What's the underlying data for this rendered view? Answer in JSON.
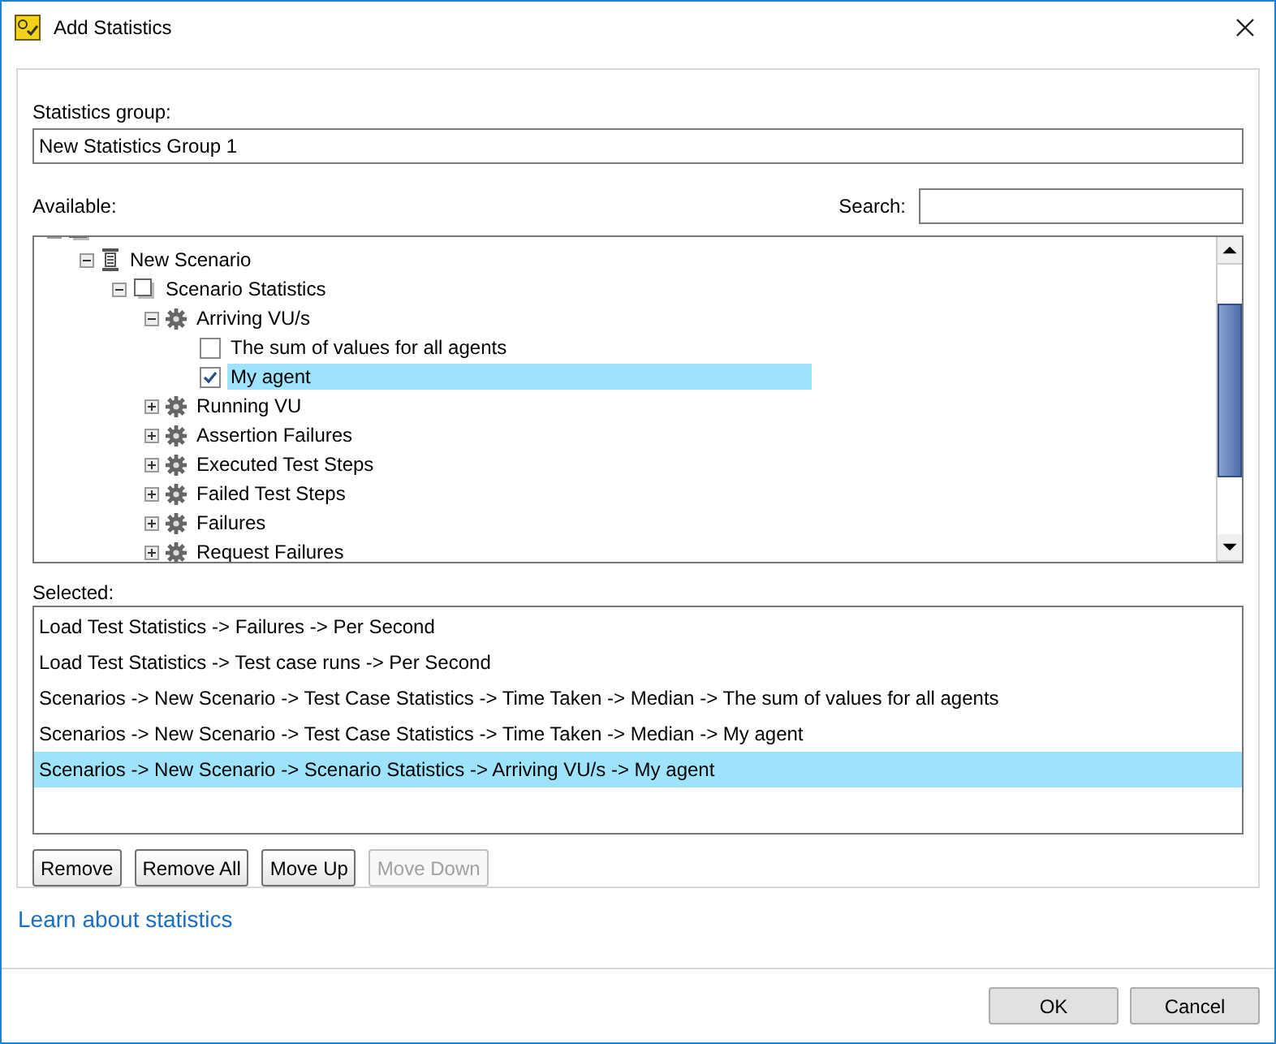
{
  "window": {
    "title": "Add Statistics"
  },
  "group_label": "Statistics group:",
  "group_name": "New Statistics Group 1",
  "available_label": "Available:",
  "search": {
    "label": "Search:"
  },
  "tree": [
    {
      "kind": "folder",
      "children": [
        {
          "label": "New Scenario",
          "kind": "scenario",
          "expanded": true,
          "children": [
            {
              "label": "Scenario Statistics",
              "kind": "folder",
              "expanded": true,
              "children": [
                {
                  "label": "Arriving VU/s",
                  "kind": "statistic",
                  "expanded": true,
                  "children": [
                    {
                      "label": "The sum of values for all agents",
                      "kind": "check",
                      "checked": false,
                      "selected": false
                    },
                    {
                      "label": "My agent",
                      "kind": "check",
                      "checked": true,
                      "selected": true
                    }
                  ]
                },
                {
                  "label": "Running VU",
                  "kind": "statistic",
                  "expanded": false
                },
                {
                  "label": "Assertion Failures",
                  "kind": "statistic",
                  "expanded": false
                },
                {
                  "label": "Executed Test Steps",
                  "kind": "statistic",
                  "expanded": false
                },
                {
                  "label": "Failed Test Steps",
                  "kind": "statistic",
                  "expanded": false
                },
                {
                  "label": "Failures",
                  "kind": "statistic",
                  "expanded": false
                },
                {
                  "label": "Request Failures",
                  "kind": "statistic",
                  "expanded": false
                }
              ]
            }
          ]
        }
      ]
    }
  ],
  "selected_label": "Selected:",
  "selected_items": [
    {
      "text": "Load Test Statistics -> Failures -> Per Second",
      "selected": false
    },
    {
      "text": "Load Test Statistics -> Test case runs -> Per Second",
      "selected": false
    },
    {
      "text": "Scenarios -> New Scenario -> Test Case Statistics -> Time Taken -> Median -> The sum of values for all agents",
      "selected": false
    },
    {
      "text": "Scenarios -> New Scenario -> Test Case Statistics -> Time Taken -> Median -> My agent",
      "selected": false
    },
    {
      "text": "Scenarios -> New Scenario -> Scenario Statistics -> Arriving VU/s -> My agent",
      "selected": true
    }
  ],
  "list_buttons": [
    {
      "label": "Remove",
      "disabled": false
    },
    {
      "label": "Remove All",
      "disabled": false
    },
    {
      "label": "Move Up",
      "disabled": false
    },
    {
      "label": "Move Down",
      "disabled": true
    }
  ],
  "link": "Learn about statistics",
  "dialog_buttons": [
    "OK",
    "Cancel"
  ]
}
